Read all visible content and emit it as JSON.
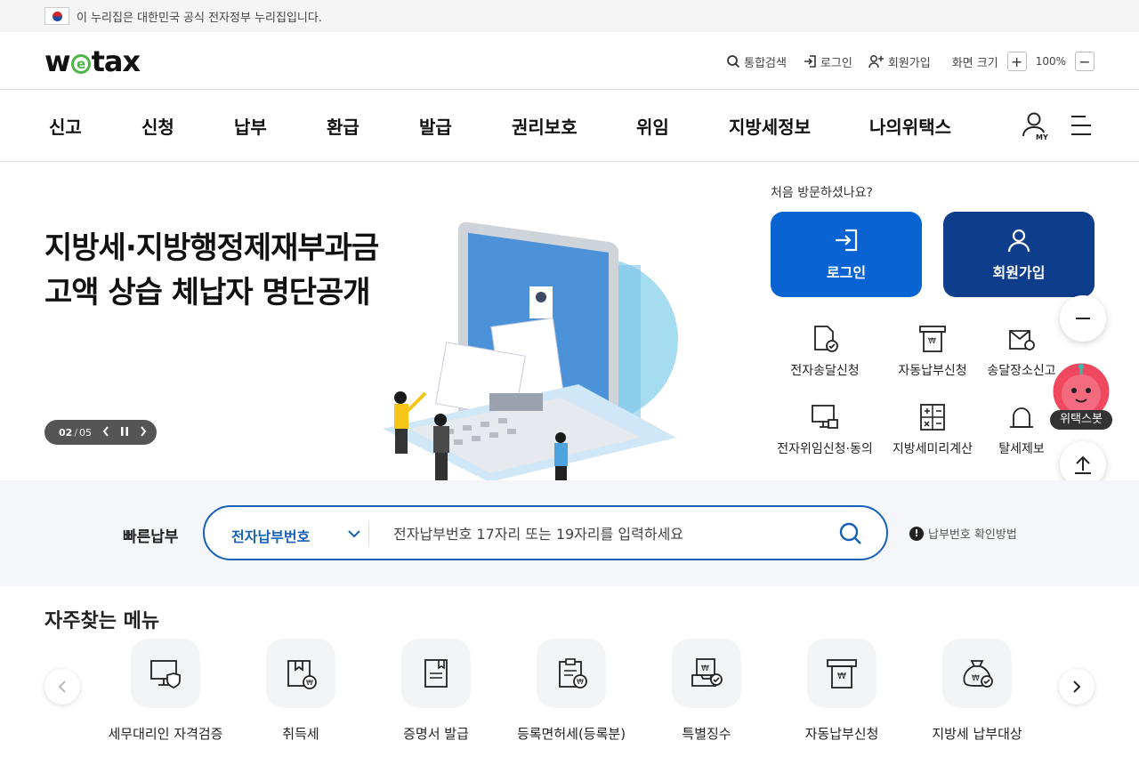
{
  "gov_banner": {
    "text": "이 누리집은 대한민국 공식 전자정부 누리집입니다."
  },
  "logo": {
    "text": "wetax"
  },
  "utility": {
    "search": "통합검색",
    "login": "로그인",
    "signup": "회원가입",
    "zoom_label": "화면 크기",
    "zoom_value": "100%"
  },
  "nav": {
    "items": [
      "신고",
      "신청",
      "납부",
      "환급",
      "발급",
      "권리보호",
      "위임",
      "지방세정보",
      "나의위택스"
    ],
    "my_label": "MY"
  },
  "hero": {
    "title_line1": "지방세·지방행정제재부과금",
    "title_line2": "고액 상습 체납자 명단공개",
    "slide_current": "02",
    "slide_total": "05"
  },
  "side": {
    "visit_text": "처음 방문하셨나요?",
    "login_button": "로그인",
    "signup_button": "회원가입",
    "quick_icons": [
      {
        "label": "전자송달신청",
        "icon": "document-check-icon"
      },
      {
        "label": "자동납부신청",
        "icon": "auto-pay-icon"
      },
      {
        "label": "송달장소신고",
        "icon": "location-mail-icon"
      },
      {
        "label": "전자위임신청·동의",
        "icon": "monitor-lock-icon"
      },
      {
        "label": "지방세미리계산",
        "icon": "calculator-icon"
      },
      {
        "label": "탈세제보",
        "icon": "bell-icon"
      }
    ],
    "bot_label": "위택스봇"
  },
  "quick_pay": {
    "label": "빠른납부",
    "select_value": "전자납부번호",
    "placeholder": "전자납부번호 17자리 또는 19자리를 입력하세요",
    "help_text": "납부번호 확인방법"
  },
  "favorites": {
    "title": "자주찾는 메뉴",
    "items": [
      {
        "label": "세무대리인 자격검증",
        "icon": "monitor-shield-icon"
      },
      {
        "label": "취득세",
        "icon": "box-won-icon"
      },
      {
        "label": "증명서 발급",
        "icon": "certificate-icon"
      },
      {
        "label": "등록면허세(등록분)",
        "icon": "clipboard-won-icon"
      },
      {
        "label": "특별징수",
        "icon": "tray-check-icon"
      },
      {
        "label": "자동납부신청",
        "icon": "auto-pay-icon"
      },
      {
        "label": "지방세 납부대상",
        "icon": "money-bag-icon"
      }
    ]
  },
  "colors": {
    "login_blue": "#0a63d3",
    "signup_navy": "#0e3d8c",
    "quickpay_border": "#1660b8",
    "logo_green": "#4cb648"
  }
}
